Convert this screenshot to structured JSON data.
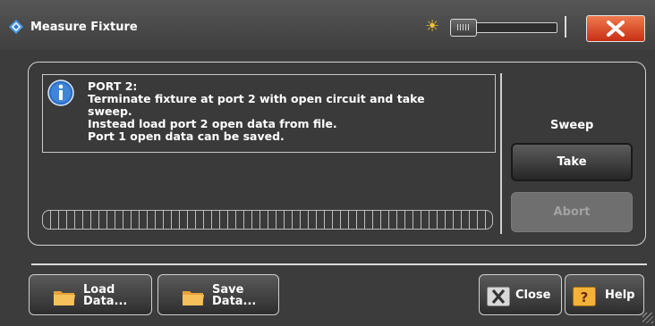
{
  "window": {
    "title": "Measure Fixture",
    "icons": {
      "logo": "rs-diamond-icon",
      "brightness": "sun-icon",
      "close": "close-x-icon"
    },
    "brightness_level": 0.2,
    "accent": "#e0542c"
  },
  "message": {
    "icon": "info-icon",
    "lines": [
      "PORT 2:",
      "Terminate fixture at port 2 with open circuit and take",
      "sweep.",
      "Instead load port 2 open data from file.",
      "Port 1 open data can be saved."
    ]
  },
  "progress": {
    "value": 0
  },
  "sweep": {
    "label": "Sweep",
    "take_label": "Take",
    "abort_label": "Abort",
    "abort_enabled": false
  },
  "footer": {
    "load_label_line1": "Load",
    "load_label_line2": "Data...",
    "save_label_line1": "Save",
    "save_label_line2": "Data...",
    "close_label": "Close",
    "help_label": "Help",
    "icons": {
      "folder": "folder-icon",
      "close": "close-icon",
      "help": "help-icon"
    }
  }
}
